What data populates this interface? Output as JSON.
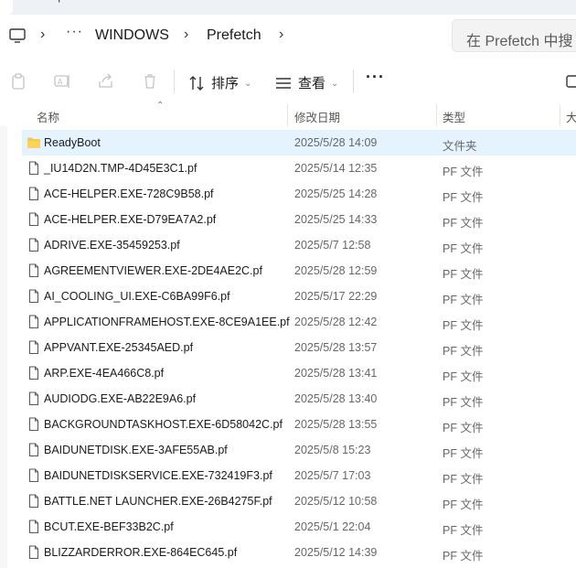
{
  "tabbar": {
    "new_tab": "+"
  },
  "address": {
    "breadcrumbs": [
      "WINDOWS",
      "Prefetch"
    ],
    "overflow": "···",
    "search_placeholder": "在 Prefetch 中搜"
  },
  "toolbar": {
    "sort_label": "排序",
    "view_label": "查看",
    "more_label": "···",
    "icons": [
      "paste-icon",
      "rename-icon",
      "share-icon",
      "delete-icon",
      "sort-icon",
      "view-icon",
      "more-icon"
    ]
  },
  "columns": {
    "name": "名称",
    "modified": "修改日期",
    "type": "类型",
    "size": "大"
  },
  "files": [
    {
      "name": "ReadyBoot",
      "modified": "2025/5/28 14:09",
      "type": "文件夹",
      "kind": "folder",
      "selected": true
    },
    {
      "name": "_IU14D2N.TMP-4D45E3C1.pf",
      "modified": "2025/5/14 12:35",
      "type": "PF 文件",
      "kind": "file"
    },
    {
      "name": "ACE-HELPER.EXE-728C9B58.pf",
      "modified": "2025/5/25 14:28",
      "type": "PF 文件",
      "kind": "file"
    },
    {
      "name": "ACE-HELPER.EXE-D79EA7A2.pf",
      "modified": "2025/5/25 14:33",
      "type": "PF 文件",
      "kind": "file"
    },
    {
      "name": "ADRIVE.EXE-35459253.pf",
      "modified": "2025/5/7 12:58",
      "type": "PF 文件",
      "kind": "file"
    },
    {
      "name": "AGREEMENTVIEWER.EXE-2DE4AE2C.pf",
      "modified": "2025/5/28 12:59",
      "type": "PF 文件",
      "kind": "file"
    },
    {
      "name": "AI_COOLING_UI.EXE-C6BA99F6.pf",
      "modified": "2025/5/17 22:29",
      "type": "PF 文件",
      "kind": "file"
    },
    {
      "name": "APPLICATIONFRAMEHOST.EXE-8CE9A1EE.pf",
      "modified": "2025/5/28 12:42",
      "type": "PF 文件",
      "kind": "file"
    },
    {
      "name": "APPVANT.EXE-25345AED.pf",
      "modified": "2025/5/28 13:57",
      "type": "PF 文件",
      "kind": "file"
    },
    {
      "name": "ARP.EXE-4EA466C8.pf",
      "modified": "2025/5/28 13:41",
      "type": "PF 文件",
      "kind": "file"
    },
    {
      "name": "AUDIODG.EXE-AB22E9A6.pf",
      "modified": "2025/5/28 13:40",
      "type": "PF 文件",
      "kind": "file"
    },
    {
      "name": "BACKGROUNDTASKHOST.EXE-6D58042C.pf",
      "modified": "2025/5/28 13:55",
      "type": "PF 文件",
      "kind": "file"
    },
    {
      "name": "BAIDUNETDISK.EXE-3AFE55AB.pf",
      "modified": "2025/5/8 15:23",
      "type": "PF 文件",
      "kind": "file"
    },
    {
      "name": "BAIDUNETDISKSERVICE.EXE-732419F3.pf",
      "modified": "2025/5/7 17:03",
      "type": "PF 文件",
      "kind": "file"
    },
    {
      "name": "BATTLE.NET LAUNCHER.EXE-26B4275F.pf",
      "modified": "2025/5/12 10:58",
      "type": "PF 文件",
      "kind": "file"
    },
    {
      "name": "BCUT.EXE-BEF33B2C.pf",
      "modified": "2025/5/1 22:04",
      "type": "PF 文件",
      "kind": "file"
    },
    {
      "name": "BLIZZARDERROR.EXE-864EC645.pf",
      "modified": "2025/5/12 14:39",
      "type": "PF 文件",
      "kind": "file"
    }
  ],
  "colors": {
    "selection": "#e5f3ff",
    "folder": "#f8c847",
    "accent": "#0067c0"
  }
}
